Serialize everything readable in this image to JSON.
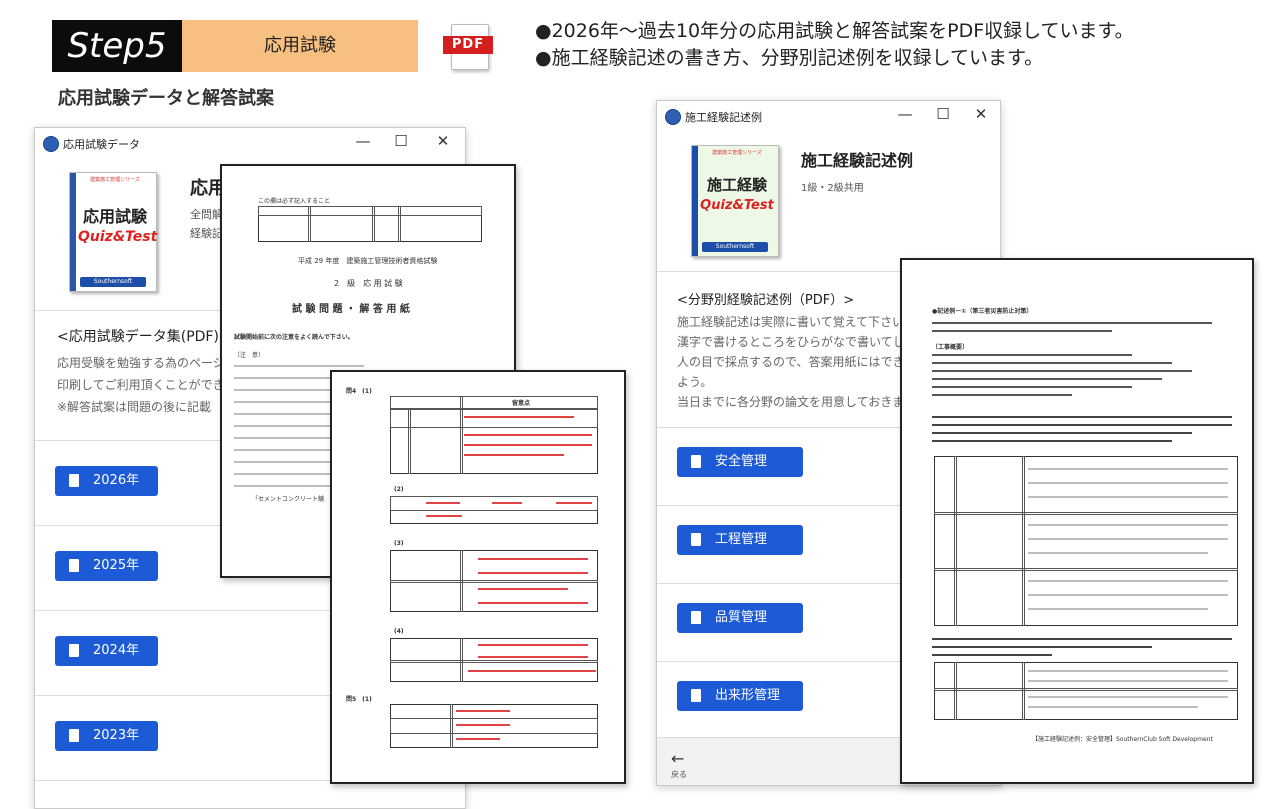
{
  "header": {
    "step_label": "Step5",
    "step_title": "応用試験",
    "pdf_label": "PDF",
    "bullet1": "●2026年～過去10年分の応用試験と解答試案をPDF収録しています。",
    "bullet2": "●施工経験記述の書き方、分野別記述例を収録しています。",
    "subheading": "応用試験データと解答試案"
  },
  "left_window": {
    "title": "応用試験データ",
    "app_name_partial": "応用",
    "desc1_partial": "全問解",
    "desc2_partial": "経験記",
    "book": {
      "top": "建築施工管理シリーズ",
      "line1": "応用試験",
      "line2": "Quiz&Test",
      "logo": "Southernsoft"
    },
    "section_title": "<応用試験データ集(PDF)>",
    "section_text1": "応用受験を勉強する為のページで",
    "section_text2": "印刷してご利用頂くことができま",
    "section_text3": "※解答試案は問題の後に記載",
    "years": [
      "2026年",
      "2025年",
      "2024年",
      "2023年"
    ]
  },
  "exam_sheet": {
    "stamp": "この欄は必ず記入すること",
    "heading1": "平成 29 年度　建築施工管理技術者資格試験",
    "heading2": "2　級　応 用 試 験",
    "heading3": "試 験 問 題 ・ 解 答 用 紙",
    "intro": "試験開始前に次の注意をよく読んで下さい。",
    "notes_label": "〔注　意〕",
    "bottom_note": "「セメントコンクリート舗"
  },
  "answer_sheet": {
    "q4_label": "問4　(1)",
    "q4_header": "留意点",
    "q5_label": "問5　(1)",
    "part2": "(2)",
    "part3": "(3)",
    "part4": "(4)"
  },
  "right_window": {
    "title": "施工経験記述例",
    "app_name": "施工経験記述例",
    "subtitle": "1級・2級共用",
    "book": {
      "top": "建築施工管理シリーズ",
      "line1": "施工経験",
      "line2": "Quiz&Test",
      "logo": "Southernsoft"
    },
    "section_title": "<分野別経験記述例（PDF）>",
    "text1": "施工経験記述は実際に書いて覚えて下さい。",
    "text2": "漢字で書けるところをひらがなで書いてしまうと",
    "text3": "人の目で採点するので、答案用紙にはできるだけ",
    "text4": "よう。",
    "text5": "当日までに各分野の論文を用意しておきましょう。",
    "buttons": [
      "安全管理",
      "工程管理",
      "品質管理",
      "出来形管理"
    ],
    "back_label": "戻る"
  },
  "example_sheet": {
    "title": "●記述例－①（第三者災害防止対策）",
    "section_label": "〔工事概要〕",
    "footer": "【施工経験記述例：安全管理】SouthernClub Soft Development"
  },
  "window_controls": {
    "minimize": "—",
    "maximize": "☐",
    "close": "✕"
  }
}
